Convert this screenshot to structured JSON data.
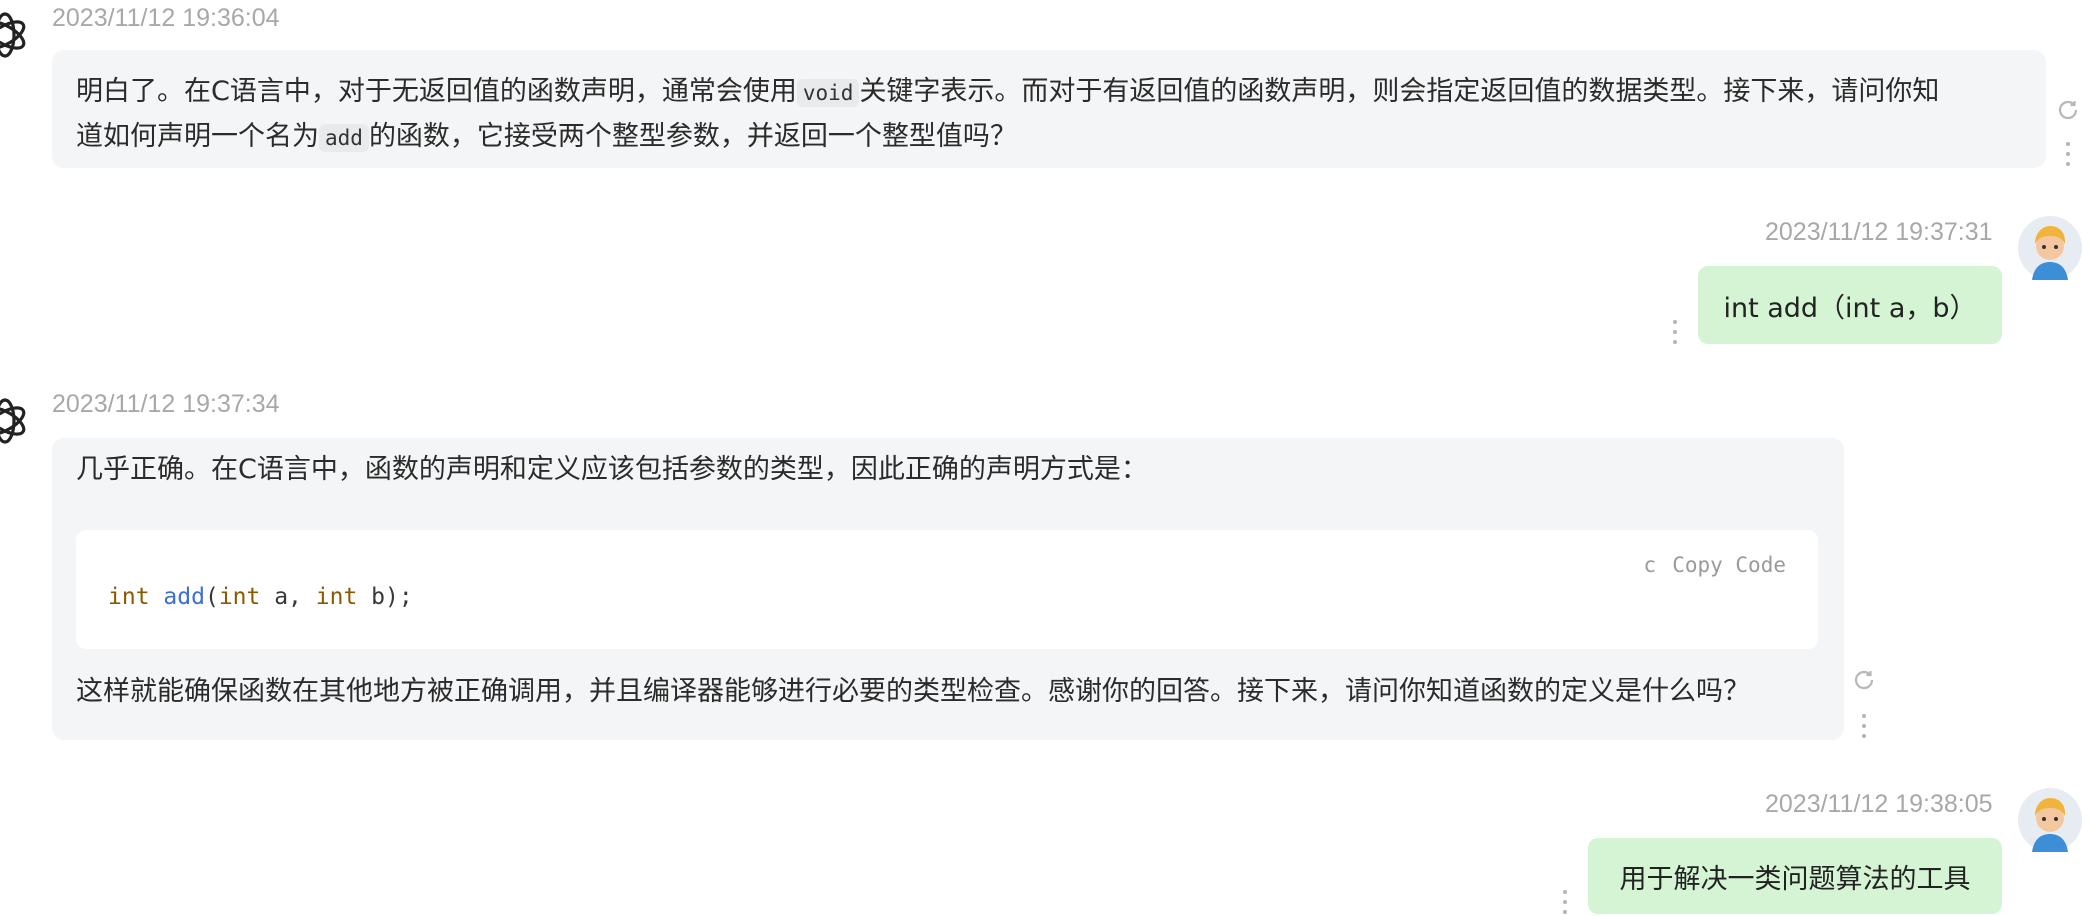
{
  "messages": [
    {
      "role": "assistant",
      "timestamp": "2023/11/12 19:36:04",
      "line1_before": "明白了。在C语言中，对于无返回值的函数声明，通常会使用",
      "line1_code": "void",
      "line1_after": "关键字表示。而对于有返回值的函数声明，则会指定返回值的数据类型。接下来，请问你知",
      "line2_before": "道如何声明一个名为",
      "line2_code": "add",
      "line2_after": "的函数，它接受两个整型参数，并返回一个整型值吗？"
    },
    {
      "role": "user",
      "timestamp": "2023/11/12 19:37:31",
      "text": "int add（int a，b）"
    },
    {
      "role": "assistant",
      "timestamp": "2023/11/12 19:37:34",
      "intro": "几乎正确。在C语言中，函数的声明和定义应该包括参数的类型，因此正确的声明方式是：",
      "code": {
        "language": "c",
        "copy_label": "Copy Code",
        "tokens": {
          "t1": "int",
          "t2": " ",
          "t3": "add",
          "t4": "(",
          "t5": "int",
          "t6": " a, ",
          "t7": "int",
          "t8": " b);"
        }
      },
      "outro": "这样就能确保函数在其他地方被正确调用，并且编译器能够进行必要的类型检查。感谢你的回答。接下来，请问你知道函数的定义是什么吗？"
    },
    {
      "role": "user",
      "timestamp": "2023/11/12 19:38:05",
      "text": "用于解决一类问题算法的工具"
    }
  ],
  "icons": {
    "assistant_avatar": "openai-logo-icon",
    "user_avatar": "cartoon-boy-avatar",
    "regenerate": "refresh-icon",
    "more": "kebab-menu-icon"
  },
  "colors": {
    "assistant_bubble": "#f4f5f6",
    "user_bubble": "#d4f4d4",
    "timestamp": "#a8a8a8",
    "code_keyword": "#8a5a00",
    "code_function": "#3d6fd1"
  }
}
